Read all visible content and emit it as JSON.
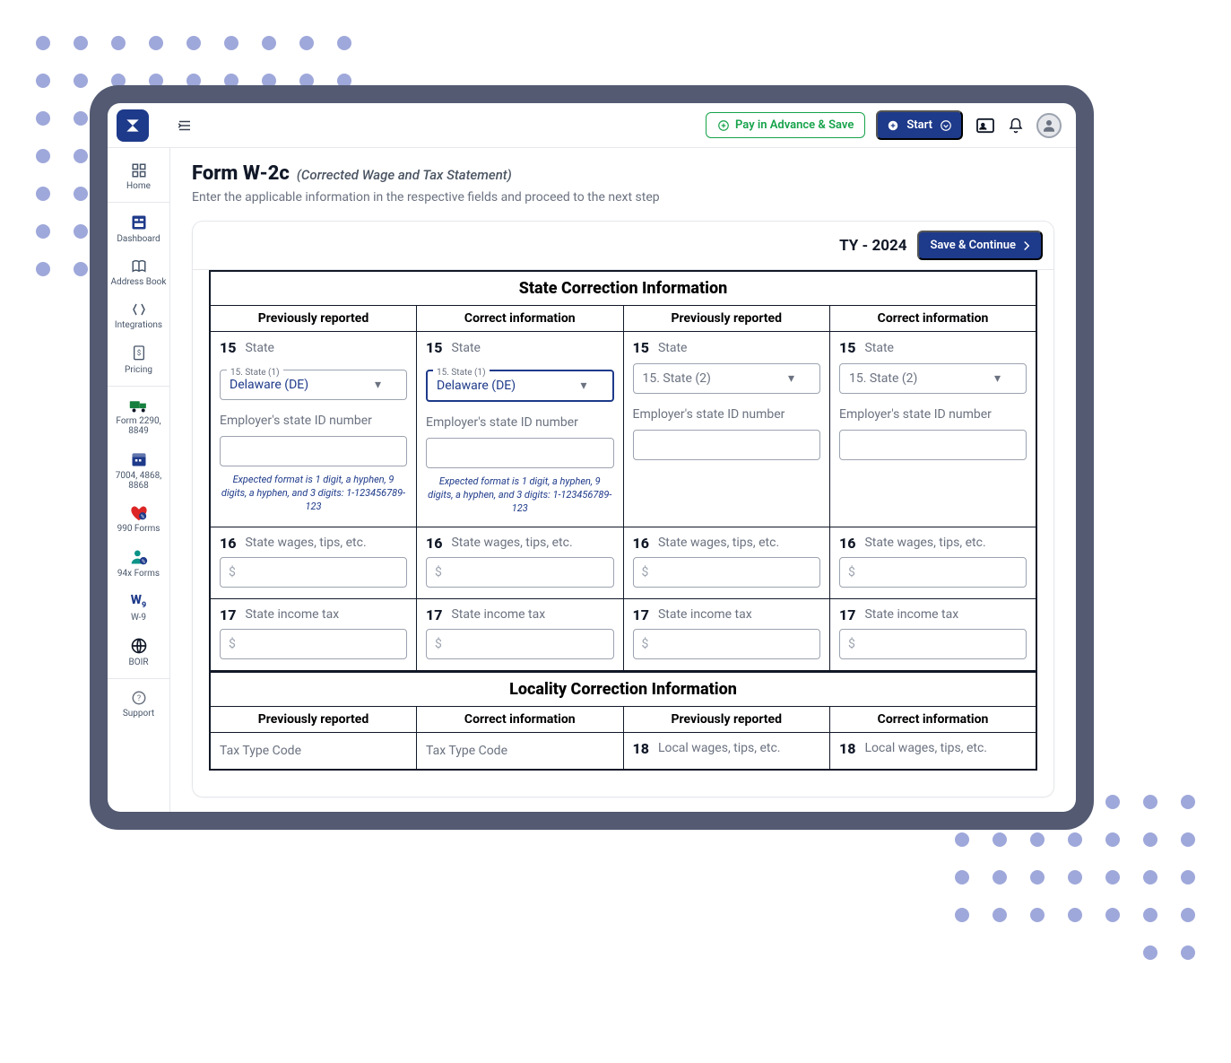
{
  "topbar": {
    "pay_label": "Pay in Advance & Save",
    "start_label": "Start"
  },
  "sidebar": [
    {
      "label": "Home"
    },
    {
      "label": "Dashboard"
    },
    {
      "label": "Address Book"
    },
    {
      "label": "Integrations"
    },
    {
      "label": "Pricing"
    },
    {
      "label": "Form 2290, 8849"
    },
    {
      "label": "7004, 4868, 8868"
    },
    {
      "label": "990 Forms"
    },
    {
      "label": "94x Forms"
    },
    {
      "label": "W-9"
    },
    {
      "label": "BOIR"
    },
    {
      "label": "Support"
    }
  ],
  "page": {
    "title": "Form W-2c",
    "subtitle_italic": "(Corrected Wage and Tax Statement)",
    "desc": "Enter the applicable information in the respective fields and proceed to the next step"
  },
  "card": {
    "ty_label": "TY - 2024",
    "save_label": "Save & Continue"
  },
  "sections": {
    "state": {
      "title": "State Correction Information",
      "col_headers": [
        "Previously reported",
        "Correct information",
        "Previously reported",
        "Correct information"
      ],
      "rows": {
        "r15": {
          "num": "15",
          "label": "State",
          "legend1": "15. State (1)",
          "legend2": "15. State (1)",
          "value_left": "Delaware (DE)",
          "value_right": "Delaware (DE)",
          "placeholder2_left": "15. State (2)",
          "placeholder2_right": "15. State (2)",
          "sub_label": "Employer's state ID number",
          "hint": "Expected format is 1 digit, a hyphen, 9 digits, a hyphen, and 3 digits: 1-123456789-123"
        },
        "r16": {
          "num": "16",
          "label": "State wages, tips, etc."
        },
        "r17": {
          "num": "17",
          "label": "State income tax"
        }
      }
    },
    "locality": {
      "title": "Locality Correction Information",
      "col_headers": [
        "Previously reported",
        "Correct information",
        "Previously reported",
        "Correct information"
      ],
      "tax_type_label": "Tax Type Code",
      "r18": {
        "num": "18",
        "label": "Local wages, tips, etc."
      }
    }
  }
}
